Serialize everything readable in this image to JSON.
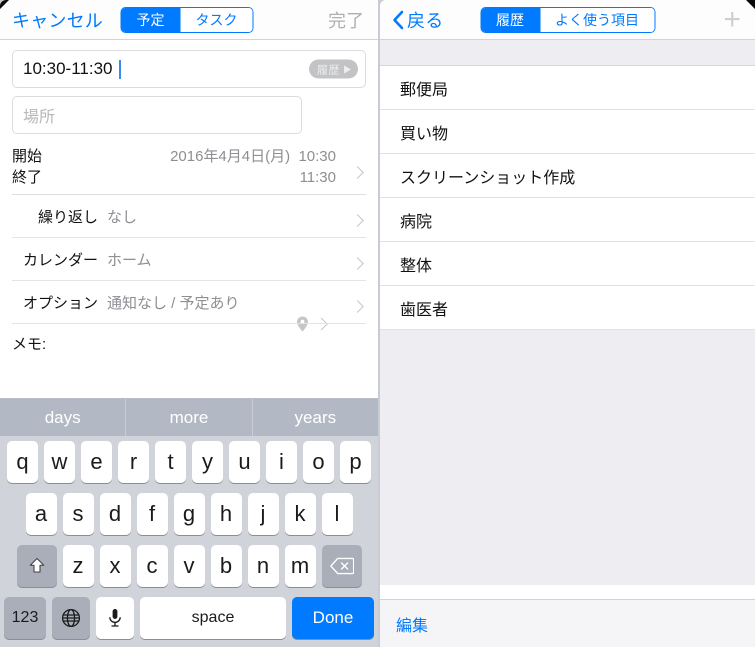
{
  "left": {
    "navbar": {
      "cancel_label": "キャンセル",
      "done_label": "完了",
      "segments": [
        {
          "label": "予定",
          "active": true
        },
        {
          "label": "タスク",
          "active": false
        }
      ]
    },
    "title_field": {
      "value": "10:30-11:30",
      "history_button_label": "履歴"
    },
    "location_field": {
      "placeholder": "場所"
    },
    "datetime": {
      "start_label": "開始",
      "end_label": "終了",
      "date": "2016年4月4日(月)",
      "start_time": "10:30",
      "end_time": "11:30"
    },
    "options": [
      {
        "label": "繰り返し",
        "value": "なし"
      },
      {
        "label": "カレンダー",
        "value": "ホーム"
      },
      {
        "label": "オプション",
        "value": "通知なし / 予定あり"
      }
    ],
    "memo_label": "メモ:",
    "keyboard": {
      "predictions": [
        "days",
        "more",
        "years"
      ],
      "row1": [
        "q",
        "w",
        "e",
        "r",
        "t",
        "y",
        "u",
        "i",
        "o",
        "p"
      ],
      "row2": [
        "a",
        "s",
        "d",
        "f",
        "g",
        "h",
        "j",
        "k",
        "l"
      ],
      "row3": [
        "z",
        "x",
        "c",
        "v",
        "b",
        "n",
        "m"
      ],
      "shift_icon": "shift-arrow-icon",
      "backspace_icon": "backspace-icon",
      "numeric_label": "123",
      "globe_icon": "globe-icon",
      "mic_icon": "microphone-icon",
      "space_label": "space",
      "done_label": "Done"
    }
  },
  "right": {
    "navbar": {
      "back_label": "戻る",
      "add_icon": "plus-icon",
      "segments": [
        {
          "label": "履歴",
          "active": true
        },
        {
          "label": "よく使う項目",
          "active": false
        }
      ]
    },
    "list_items": [
      {
        "label": "郵便局"
      },
      {
        "label": "買い物"
      },
      {
        "label": "スクリーンショット作成"
      },
      {
        "label": "病院"
      },
      {
        "label": "整体"
      },
      {
        "label": "歯医者"
      }
    ],
    "bottom_bar": {
      "edit_label": "編集"
    }
  },
  "colors": {
    "accent": "#007aff",
    "list_bg": "#eeeef2",
    "keyboard_bg": "#d0d3da",
    "predict_bg": "#b3b9c4"
  }
}
